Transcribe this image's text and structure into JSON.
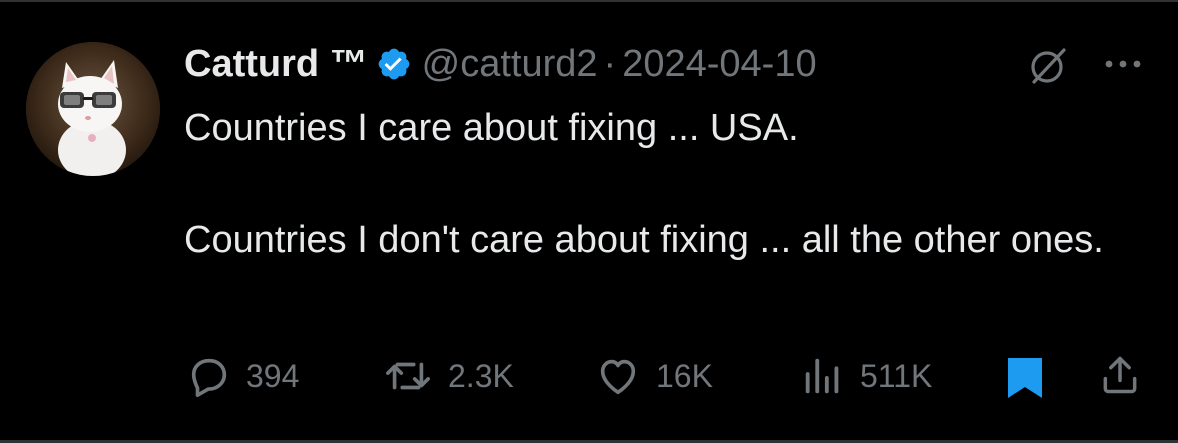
{
  "tweet": {
    "display_name": "Catturd ™",
    "verified": true,
    "handle": "@catturd2",
    "separator": "·",
    "date": "2024-04-10",
    "text_lines": [
      "Countries I care about fixing ... USA.",
      "Countries I don't care about fixing ... all the other ones."
    ]
  },
  "actions": {
    "reply_count": "394",
    "retweet_count": "2.3K",
    "like_count": "16K",
    "view_count": "511K",
    "bookmarked": true
  },
  "icons": {
    "verified_badge": "verified-badge-icon",
    "grok": "grok-icon",
    "more": "more-dots-icon",
    "reply": "reply-bubble-icon",
    "retweet": "retweet-icon",
    "like": "heart-icon",
    "views": "views-bar-icon",
    "bookmark": "bookmark-icon",
    "share": "share-icon"
  },
  "colors": {
    "background": "#000000",
    "primary_text": "#e7e9ea",
    "secondary_text": "#71767b",
    "accent": "#1d9bf0",
    "divider": "#2f3336"
  }
}
